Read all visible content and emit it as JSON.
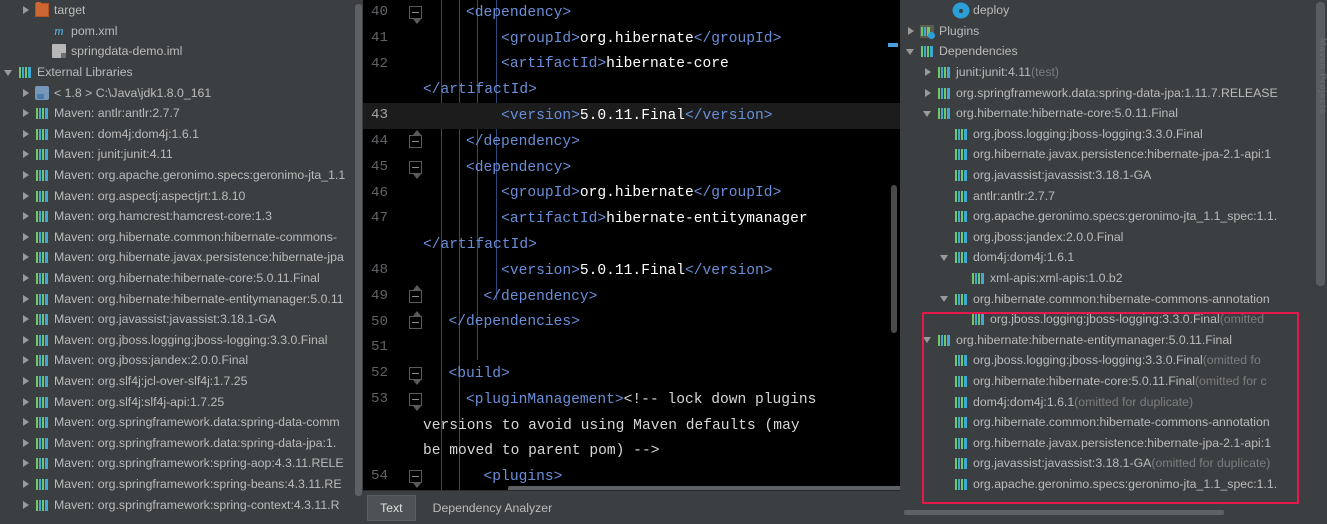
{
  "project_tree": {
    "name": "project-tree",
    "rows": [
      {
        "indent": 1,
        "arrow": "right",
        "icon": "folder-orange-icon",
        "label": "target"
      },
      {
        "indent": 2,
        "arrow": "none",
        "icon": "maven-pom-icon",
        "label": "pom.xml"
      },
      {
        "indent": 2,
        "arrow": "none",
        "icon": "module-iml-icon",
        "label": "springdata-demo.iml"
      },
      {
        "indent": 0,
        "arrow": "down",
        "icon": "library-icon",
        "label": "External Libraries"
      },
      {
        "indent": 1,
        "arrow": "right",
        "icon": "jdk-icon",
        "label": "< 1.8 >  C:\\Java\\jdk1.8.0_161"
      },
      {
        "indent": 1,
        "arrow": "right",
        "icon": "maven-lib-icon",
        "label": "Maven: antlr:antlr:2.7.7"
      },
      {
        "indent": 1,
        "arrow": "right",
        "icon": "maven-lib-icon",
        "label": "Maven: dom4j:dom4j:1.6.1"
      },
      {
        "indent": 1,
        "arrow": "right",
        "icon": "maven-lib-icon",
        "label": "Maven: junit:junit:4.11"
      },
      {
        "indent": 1,
        "arrow": "right",
        "icon": "maven-lib-icon",
        "label": "Maven: org.apache.geronimo.specs:geronimo-jta_1.1"
      },
      {
        "indent": 1,
        "arrow": "right",
        "icon": "maven-lib-icon",
        "label": "Maven: org.aspectj:aspectjrt:1.8.10"
      },
      {
        "indent": 1,
        "arrow": "right",
        "icon": "maven-lib-icon",
        "label": "Maven: org.hamcrest:hamcrest-core:1.3"
      },
      {
        "indent": 1,
        "arrow": "right",
        "icon": "maven-lib-icon",
        "label": "Maven: org.hibernate.common:hibernate-commons-"
      },
      {
        "indent": 1,
        "arrow": "right",
        "icon": "maven-lib-icon",
        "label": "Maven: org.hibernate.javax.persistence:hibernate-jpa"
      },
      {
        "indent": 1,
        "arrow": "right",
        "icon": "maven-lib-icon",
        "label": "Maven: org.hibernate:hibernate-core:5.0.11.Final"
      },
      {
        "indent": 1,
        "arrow": "right",
        "icon": "maven-lib-icon",
        "label": "Maven: org.hibernate:hibernate-entitymanager:5.0.11"
      },
      {
        "indent": 1,
        "arrow": "right",
        "icon": "maven-lib-icon",
        "label": "Maven: org.javassist:javassist:3.18.1-GA"
      },
      {
        "indent": 1,
        "arrow": "right",
        "icon": "maven-lib-icon",
        "label": "Maven: org.jboss.logging:jboss-logging:3.3.0.Final"
      },
      {
        "indent": 1,
        "arrow": "right",
        "icon": "maven-lib-icon",
        "label": "Maven: org.jboss:jandex:2.0.0.Final"
      },
      {
        "indent": 1,
        "arrow": "right",
        "icon": "maven-lib-icon",
        "label": "Maven: org.slf4j:jcl-over-slf4j:1.7.25"
      },
      {
        "indent": 1,
        "arrow": "right",
        "icon": "maven-lib-icon",
        "label": "Maven: org.slf4j:slf4j-api:1.7.25"
      },
      {
        "indent": 1,
        "arrow": "right",
        "icon": "maven-lib-icon",
        "label": "Maven: org.springframework.data:spring-data-comm"
      },
      {
        "indent": 1,
        "arrow": "right",
        "icon": "maven-lib-icon",
        "label": "Maven: org.springframework.data:spring-data-jpa:1."
      },
      {
        "indent": 1,
        "arrow": "right",
        "icon": "maven-lib-icon",
        "label": "Maven: org.springframework:spring-aop:4.3.11.RELE"
      },
      {
        "indent": 1,
        "arrow": "right",
        "icon": "maven-lib-icon",
        "label": "Maven: org.springframework:spring-beans:4.3.11.RE"
      },
      {
        "indent": 1,
        "arrow": "right",
        "icon": "maven-lib-icon",
        "label": "Maven: org.springframework:spring-context:4.3.11.R"
      }
    ]
  },
  "editor": {
    "name": "pom-xml-editor",
    "current_line": 43,
    "lines": [
      {
        "num": "40",
        "text": "    <dependency>",
        "fold": "tip-down",
        "kind": "tag"
      },
      {
        "num": "41",
        "text": "        <groupId>org.hibernate</groupId>",
        "fold": "",
        "kind": "mixed"
      },
      {
        "num": "42",
        "text": "        <artifactId>hibernate-core",
        "fold": "",
        "kind": "mixed"
      },
      {
        "num": "",
        "text": "</artifactId>",
        "fold": "",
        "kind": "tag",
        "wrap": true
      },
      {
        "num": "43",
        "text": "        <version>5.0.11.Final</version>",
        "fold": "",
        "kind": "mixed",
        "highlight": true
      },
      {
        "num": "44",
        "text": "    </dependency>",
        "fold": "tip-up",
        "kind": "tag"
      },
      {
        "num": "45",
        "text": "    <dependency>",
        "fold": "tip-down",
        "kind": "tag"
      },
      {
        "num": "46",
        "text": "        <groupId>org.hibernate</groupId>",
        "fold": "",
        "kind": "mixed"
      },
      {
        "num": "47",
        "text": "        <artifactId>hibernate-entitymanager",
        "fold": "",
        "kind": "mixed"
      },
      {
        "num": "",
        "text": "</artifactId>",
        "fold": "",
        "kind": "tag",
        "wrap": true
      },
      {
        "num": "48",
        "text": "        <version>5.0.11.Final</version>",
        "fold": "",
        "kind": "mixed"
      },
      {
        "num": "49",
        "text": "      </dependency>",
        "fold": "tip-up",
        "kind": "tag"
      },
      {
        "num": "50",
        "text": "  </dependencies>",
        "fold": "tip-up",
        "kind": "tag"
      },
      {
        "num": "51",
        "text": "",
        "fold": "",
        "kind": "tag"
      },
      {
        "num": "52",
        "text": "  <build>",
        "fold": "tip-down",
        "kind": "tag"
      },
      {
        "num": "53",
        "text": "    <pluginManagement><!-- lock down plugins",
        "fold": "tip-down",
        "kind": "comment1"
      },
      {
        "num": "",
        "text": "versions to avoid using Maven defaults (may",
        "fold": "",
        "kind": "comment",
        "wrap": true
      },
      {
        "num": "",
        "text": "be moved to parent pom) -->",
        "fold": "",
        "kind": "comment",
        "wrap": true
      },
      {
        "num": "54",
        "text": "      <plugins>",
        "fold": "tip-down",
        "kind": "tag"
      }
    ],
    "tabs": [
      {
        "label": "Text",
        "active": true
      },
      {
        "label": "Dependency Analyzer",
        "active": false
      }
    ]
  },
  "dependency_tree": {
    "name": "maven-dependencies-tree",
    "rows": [
      {
        "indent": 2,
        "arrow": "none",
        "icon": "gear-icon",
        "label": "deploy",
        "suffix": ""
      },
      {
        "indent": 0,
        "arrow": "right",
        "icon": "plugins-icon",
        "label": "Plugins",
        "suffix": ""
      },
      {
        "indent": 0,
        "arrow": "down",
        "icon": "maven-lib-icon",
        "label": "Dependencies",
        "suffix": ""
      },
      {
        "indent": 1,
        "arrow": "right",
        "icon": "maven-lib-icon",
        "label": "junit:junit:4.11",
        "suffix": " (test)"
      },
      {
        "indent": 1,
        "arrow": "right",
        "icon": "maven-lib-icon",
        "label": "org.springframework.data:spring-data-jpa:1.11.7.RELEASE",
        "suffix": ""
      },
      {
        "indent": 1,
        "arrow": "down",
        "icon": "maven-lib-icon",
        "label": "org.hibernate:hibernate-core:5.0.11.Final",
        "suffix": ""
      },
      {
        "indent": 2,
        "arrow": "none",
        "icon": "maven-lib-icon",
        "label": "org.jboss.logging:jboss-logging:3.3.0.Final",
        "suffix": ""
      },
      {
        "indent": 2,
        "arrow": "none",
        "icon": "maven-lib-icon",
        "label": "org.hibernate.javax.persistence:hibernate-jpa-2.1-api:1",
        "suffix": ""
      },
      {
        "indent": 2,
        "arrow": "none",
        "icon": "maven-lib-icon",
        "label": "org.javassist:javassist:3.18.1-GA",
        "suffix": ""
      },
      {
        "indent": 2,
        "arrow": "none",
        "icon": "maven-lib-icon",
        "label": "antlr:antlr:2.7.7",
        "suffix": ""
      },
      {
        "indent": 2,
        "arrow": "none",
        "icon": "maven-lib-icon",
        "label": "org.apache.geronimo.specs:geronimo-jta_1.1_spec:1.1.",
        "suffix": ""
      },
      {
        "indent": 2,
        "arrow": "none",
        "icon": "maven-lib-icon",
        "label": "org.jboss:jandex:2.0.0.Final",
        "suffix": ""
      },
      {
        "indent": 2,
        "arrow": "down",
        "icon": "maven-lib-icon",
        "label": "dom4j:dom4j:1.6.1",
        "suffix": ""
      },
      {
        "indent": 3,
        "arrow": "none",
        "icon": "maven-lib-icon",
        "label": "xml-apis:xml-apis:1.0.b2",
        "suffix": ""
      },
      {
        "indent": 2,
        "arrow": "down",
        "icon": "maven-lib-icon",
        "label": "org.hibernate.common:hibernate-commons-annotation",
        "suffix": ""
      },
      {
        "indent": 3,
        "arrow": "none",
        "icon": "maven-lib-icon",
        "label": "org.jboss.logging:jboss-logging:3.3.0.Final",
        "suffix": " (omitted"
      },
      {
        "indent": 1,
        "arrow": "down",
        "icon": "maven-lib-icon",
        "label": "org.hibernate:hibernate-entitymanager:5.0.11.Final",
        "suffix": ""
      },
      {
        "indent": 2,
        "arrow": "none",
        "icon": "maven-lib-icon",
        "label": "org.jboss.logging:jboss-logging:3.3.0.Final",
        "suffix": " (omitted fo"
      },
      {
        "indent": 2,
        "arrow": "none",
        "icon": "maven-lib-icon",
        "label": "org.hibernate:hibernate-core:5.0.11.Final",
        "suffix": " (omitted for c"
      },
      {
        "indent": 2,
        "arrow": "none",
        "icon": "maven-lib-icon",
        "label": "dom4j:dom4j:1.6.1",
        "suffix": " (omitted for duplicate)"
      },
      {
        "indent": 2,
        "arrow": "none",
        "icon": "maven-lib-icon",
        "label": "org.hibernate.common:hibernate-commons-annotation",
        "suffix": ""
      },
      {
        "indent": 2,
        "arrow": "none",
        "icon": "maven-lib-icon",
        "label": "org.hibernate.javax.persistence:hibernate-jpa-2.1-api:1",
        "suffix": ""
      },
      {
        "indent": 2,
        "arrow": "none",
        "icon": "maven-lib-icon",
        "label": "org.javassist:javassist:3.18.1-GA",
        "suffix": " (omitted for duplicate)"
      },
      {
        "indent": 2,
        "arrow": "none",
        "icon": "maven-lib-icon",
        "label": "org.apache.geronimo.specs:geronimo-jta_1.1_spec:1.1.",
        "suffix": ""
      }
    ],
    "highlight_box": {
      "color": "#e5194b"
    },
    "side_label": "Maven Projects"
  },
  "colors": {
    "panel_bg": "#3c3f41",
    "editor_bg": "#000000",
    "text": "#bbbbbb",
    "tag": "#6a8fd8",
    "highlight_red": "#e5194b",
    "current_line": "#1c1c1c"
  }
}
